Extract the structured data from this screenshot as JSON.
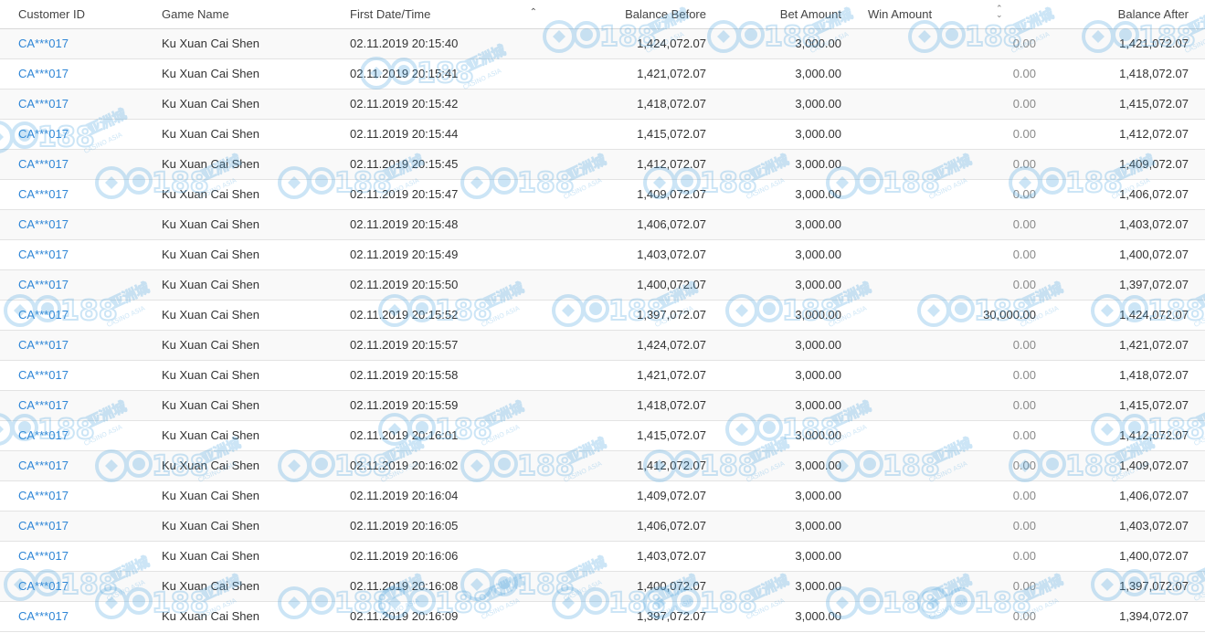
{
  "table": {
    "columns": {
      "customer_id": "Customer ID",
      "game_name": "Game Name",
      "first_date_time": "First Date/Time",
      "balance_before": "Balance Before",
      "bet_amount": "Bet Amount",
      "win_amount": "Win Amount",
      "balance_after": "Balance After"
    },
    "rows": [
      {
        "customer_id": "CA***017",
        "game": "Ku Xuan Cai Shen",
        "datetime": "02.11.2019 20:15:40",
        "balance_before": "1,424,072.07",
        "bet": "3,000.00",
        "win": "0.00",
        "balance_after": "1,421,072.07"
      },
      {
        "customer_id": "CA***017",
        "game": "Ku Xuan Cai Shen",
        "datetime": "02.11.2019 20:15:41",
        "balance_before": "1,421,072.07",
        "bet": "3,000.00",
        "win": "0.00",
        "balance_after": "1,418,072.07"
      },
      {
        "customer_id": "CA***017",
        "game": "Ku Xuan Cai Shen",
        "datetime": "02.11.2019 20:15:42",
        "balance_before": "1,418,072.07",
        "bet": "3,000.00",
        "win": "0.00",
        "balance_after": "1,415,072.07"
      },
      {
        "customer_id": "CA***017",
        "game": "Ku Xuan Cai Shen",
        "datetime": "02.11.2019 20:15:44",
        "balance_before": "1,415,072.07",
        "bet": "3,000.00",
        "win": "0.00",
        "balance_after": "1,412,072.07"
      },
      {
        "customer_id": "CA***017",
        "game": "Ku Xuan Cai Shen",
        "datetime": "02.11.2019 20:15:45",
        "balance_before": "1,412,072.07",
        "bet": "3,000.00",
        "win": "0.00",
        "balance_after": "1,409,072.07"
      },
      {
        "customer_id": "CA***017",
        "game": "Ku Xuan Cai Shen",
        "datetime": "02.11.2019 20:15:47",
        "balance_before": "1,409,072.07",
        "bet": "3,000.00",
        "win": "0.00",
        "balance_after": "1,406,072.07"
      },
      {
        "customer_id": "CA***017",
        "game": "Ku Xuan Cai Shen",
        "datetime": "02.11.2019 20:15:48",
        "balance_before": "1,406,072.07",
        "bet": "3,000.00",
        "win": "0.00",
        "balance_after": "1,403,072.07"
      },
      {
        "customer_id": "CA***017",
        "game": "Ku Xuan Cai Shen",
        "datetime": "02.11.2019 20:15:49",
        "balance_before": "1,403,072.07",
        "bet": "3,000.00",
        "win": "0.00",
        "balance_after": "1,400,072.07"
      },
      {
        "customer_id": "CA***017",
        "game": "Ku Xuan Cai Shen",
        "datetime": "02.11.2019 20:15:50",
        "balance_before": "1,400,072.07",
        "bet": "3,000.00",
        "win": "0.00",
        "balance_after": "1,397,072.07"
      },
      {
        "customer_id": "CA***017",
        "game": "Ku Xuan Cai Shen",
        "datetime": "02.11.2019 20:15:52",
        "balance_before": "1,397,072.07",
        "bet": "3,000.00",
        "win": "30,000.00",
        "balance_after": "1,424,072.07"
      },
      {
        "customer_id": "CA***017",
        "game": "Ku Xuan Cai Shen",
        "datetime": "02.11.2019 20:15:57",
        "balance_before": "1,424,072.07",
        "bet": "3,000.00",
        "win": "0.00",
        "balance_after": "1,421,072.07"
      },
      {
        "customer_id": "CA***017",
        "game": "Ku Xuan Cai Shen",
        "datetime": "02.11.2019 20:15:58",
        "balance_before": "1,421,072.07",
        "bet": "3,000.00",
        "win": "0.00",
        "balance_after": "1,418,072.07"
      },
      {
        "customer_id": "CA***017",
        "game": "Ku Xuan Cai Shen",
        "datetime": "02.11.2019 20:15:59",
        "balance_before": "1,418,072.07",
        "bet": "3,000.00",
        "win": "0.00",
        "balance_after": "1,415,072.07"
      },
      {
        "customer_id": "CA***017",
        "game": "Ku Xuan Cai Shen",
        "datetime": "02.11.2019 20:16:01",
        "balance_before": "1,415,072.07",
        "bet": "3,000.00",
        "win": "0.00",
        "balance_after": "1,412,072.07"
      },
      {
        "customer_id": "CA***017",
        "game": "Ku Xuan Cai Shen",
        "datetime": "02.11.2019 20:16:02",
        "balance_before": "1,412,072.07",
        "bet": "3,000.00",
        "win": "0.00",
        "balance_after": "1,409,072.07"
      },
      {
        "customer_id": "CA***017",
        "game": "Ku Xuan Cai Shen",
        "datetime": "02.11.2019 20:16:04",
        "balance_before": "1,409,072.07",
        "bet": "3,000.00",
        "win": "0.00",
        "balance_after": "1,406,072.07"
      },
      {
        "customer_id": "CA***017",
        "game": "Ku Xuan Cai Shen",
        "datetime": "02.11.2019 20:16:05",
        "balance_before": "1,406,072.07",
        "bet": "3,000.00",
        "win": "0.00",
        "balance_after": "1,403,072.07"
      },
      {
        "customer_id": "CA***017",
        "game": "Ku Xuan Cai Shen",
        "datetime": "02.11.2019 20:16:06",
        "balance_before": "1,403,072.07",
        "bet": "3,000.00",
        "win": "0.00",
        "balance_after": "1,400,072.07"
      },
      {
        "customer_id": "CA***017",
        "game": "Ku Xuan Cai Shen",
        "datetime": "02.11.2019 20:16:08",
        "balance_before": "1,400,072.07",
        "bet": "3,000.00",
        "win": "0.00",
        "balance_after": "1,397,072.07"
      },
      {
        "customer_id": "CA***017",
        "game": "Ku Xuan Cai Shen",
        "datetime": "02.11.2019 20:16:09",
        "balance_before": "1,397,072.07",
        "bet": "3,000.00",
        "win": "0.00",
        "balance_after": "1,394,072.07"
      }
    ]
  },
  "watermark": {
    "brand": "188",
    "cn_text": "亚洲城",
    "en_text": "CASINO ASIA",
    "color": "#4aa3df"
  },
  "icons": {
    "sort_ascending": "chevron-up-icon",
    "sort_unsorted": "sort-both-icon"
  },
  "colors": {
    "link": "#2f86d6",
    "zero_amount": "#8a8a8a"
  }
}
